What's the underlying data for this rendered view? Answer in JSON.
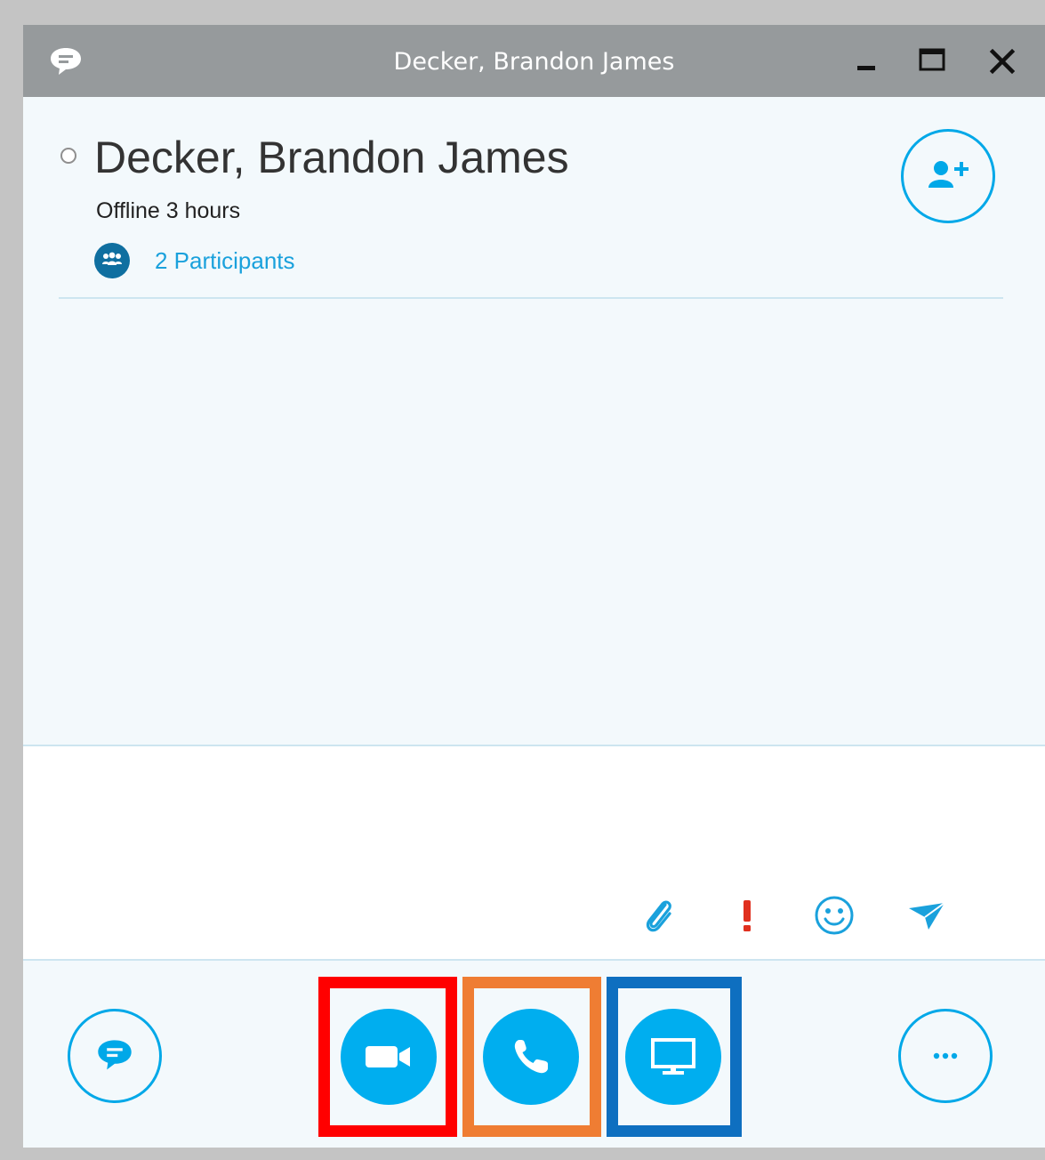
{
  "window": {
    "title": "Decker, Brandon James",
    "controls": {
      "minimize": "minimize",
      "maximize": "maximize",
      "close": "close"
    }
  },
  "contact": {
    "name": "Decker, Brandon James",
    "status": "Offline 3 hours",
    "participants_label": "2 Participants",
    "presence": "offline"
  },
  "compose": {
    "placeholder": "",
    "tools": [
      "attach-icon",
      "important-icon",
      "emoticon-icon",
      "send-icon"
    ],
    "important_glyph": "!"
  },
  "bottom_bar": {
    "buttons": [
      "im-icon",
      "video-icon",
      "phone-icon",
      "screen-share-icon",
      "more-options-icon"
    ],
    "highlights": [
      {
        "target": "video-call-button",
        "color": "#ff0000"
      },
      {
        "target": "audio-call-button",
        "color": "#ef7d33"
      },
      {
        "target": "present-screen-button",
        "color": "#0e6fc0"
      }
    ]
  },
  "colors": {
    "accent": "#00aeef",
    "titlebar": "#969a9c",
    "link": "#1aa1dc",
    "important": "#e0301e"
  }
}
